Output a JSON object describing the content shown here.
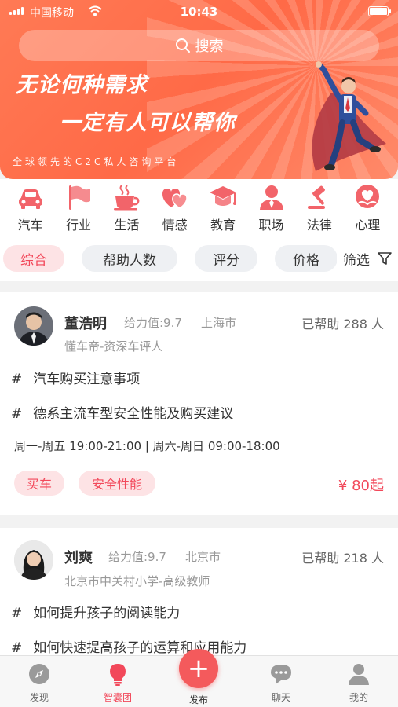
{
  "status_bar": {
    "carrier": "中国移动",
    "time": "10:43"
  },
  "search": {
    "placeholder": "搜索"
  },
  "banner": {
    "slogan_line1": "无论何种需求",
    "slogan_line2": "一定有人可以帮你",
    "tagline": "全球领先的C2C私人咨询平台"
  },
  "categories": [
    {
      "label": "汽车",
      "icon": "car-icon"
    },
    {
      "label": "行业",
      "icon": "flag-icon"
    },
    {
      "label": "生活",
      "icon": "coffee-cup-icon"
    },
    {
      "label": "情感",
      "icon": "hearts-icon"
    },
    {
      "label": "教育",
      "icon": "graduation-cap-icon"
    },
    {
      "label": "职场",
      "icon": "person-icon"
    },
    {
      "label": "法律",
      "icon": "gavel-icon"
    },
    {
      "label": "心理",
      "icon": "heart-hand-icon"
    }
  ],
  "filters": {
    "sort_options": [
      "综合",
      "帮助人数",
      "评分",
      "价格"
    ],
    "active": "综合",
    "filter_label": "筛选"
  },
  "experts": [
    {
      "name": "董浩明",
      "power": "给力值:9.7",
      "city": "上海市",
      "helped": "已帮助 288 人",
      "role": "懂车帝-资深车评人",
      "topics": [
        "汽车购买注意事项",
        "德系主流车型安全性能及购买建议"
      ],
      "hours": "周一-周五 19:00-21:00 | 周六-周日 09:00-18:00",
      "tags": [
        "买车",
        "安全性能"
      ],
      "price": "¥ 80起"
    },
    {
      "name": "刘爽",
      "power": "给力值:9.7",
      "city": "北京市",
      "helped": "已帮助 218 人",
      "role": "北京市中关村小学-高级教师",
      "topics": [
        "如何提升孩子的阅读能力",
        "如何快速提高孩子的运算和应用能力"
      ]
    }
  ],
  "topic_prefix": "#",
  "tabbar": {
    "items": [
      "发现",
      "智囊团",
      "发布",
      "聊天",
      "我的"
    ],
    "active": "智囊团"
  },
  "colors": {
    "accent": "#f2485a",
    "banner": "#ff6f4d",
    "icon": "#f2646a"
  }
}
